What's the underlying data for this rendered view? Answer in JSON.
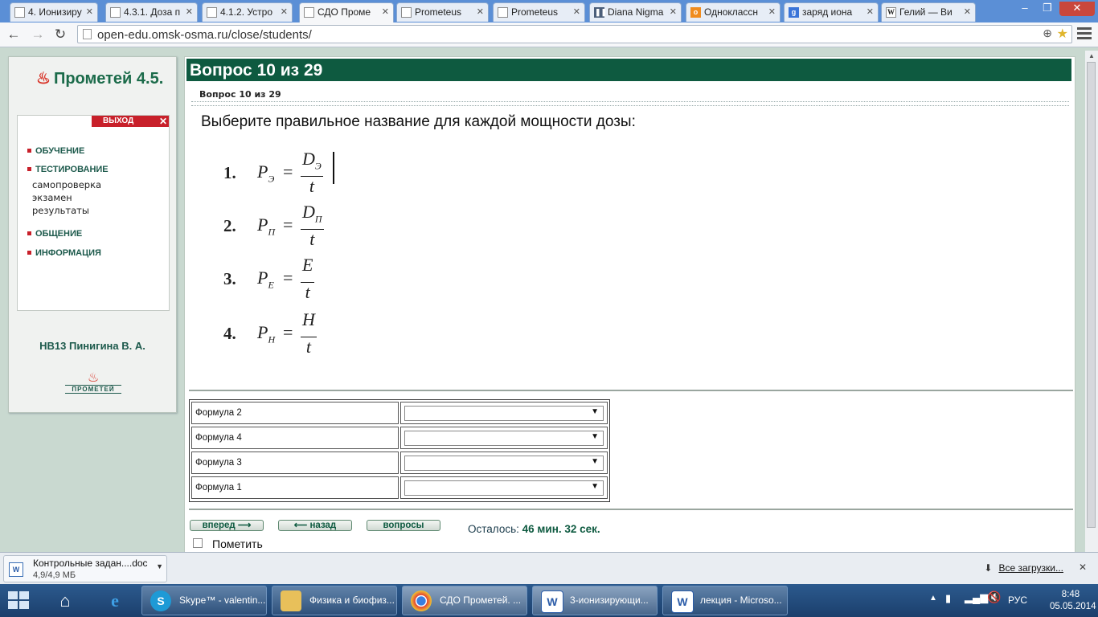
{
  "browser": {
    "tabs": [
      {
        "label": "4. Ионизиру",
        "icon": "document-icon"
      },
      {
        "label": "4.3.1. Доза п",
        "icon": "document-icon"
      },
      {
        "label": "4.1.2. Устро",
        "icon": "document-icon"
      },
      {
        "label": "СДО Проме",
        "icon": "document-icon",
        "active": true
      },
      {
        "label": "Prometeus",
        "icon": "document-icon"
      },
      {
        "label": "Prometeus",
        "icon": "document-icon"
      },
      {
        "label": "Diana Nigma",
        "icon": "pause-icon"
      },
      {
        "label": "Одноклассн",
        "icon": "odnoklassniki-icon"
      },
      {
        "label": "заряд иона",
        "icon": "google-icon"
      },
      {
        "label": "Гелий — Ви",
        "icon": "wikipedia-icon"
      }
    ],
    "url": "open-edu.omsk-osma.ru/close/students/"
  },
  "sidebar": {
    "logo_text": "Прометей 4.5.",
    "exit_label": "ВЫХОД",
    "menu": {
      "learning": "ОБУЧЕНИЕ",
      "testing": "ТЕСТИРОВАНИЕ",
      "self_check": "самопроверка",
      "exam": "экзамен",
      "results": "результаты",
      "communication": "ОБЩЕНИЕ",
      "information": "ИНФОРМАЦИЯ"
    },
    "user_name": "НВ13 Пинигина В. А.",
    "bottom_logo_text": "ПРОМЕТЕЙ"
  },
  "question": {
    "header": "Вопрос 10 из 29",
    "subheader": "Вопрос 10 из 29",
    "text": "Выберите правильное название для каждой мощности дозы:",
    "formulas": [
      {
        "num": "1.",
        "p": "P",
        "p_sub": "Э",
        "eq": "=",
        "numerator": "D",
        "numerator_sub": "Э",
        "denominator": "t"
      },
      {
        "num": "2.",
        "p": "P",
        "p_sub": "П",
        "eq": "=",
        "numerator": "D",
        "numerator_sub": "П",
        "denominator": "t"
      },
      {
        "num": "3.",
        "p": "P",
        "p_sub": "E",
        "eq": "=",
        "numerator": "E",
        "numerator_sub": "",
        "denominator": "t"
      },
      {
        "num": "4.",
        "p": "P",
        "p_sub": "H",
        "eq": "=",
        "numerator": "H",
        "numerator_sub": "",
        "denominator": "t"
      }
    ],
    "matching": [
      {
        "label": "Формула 2",
        "selected": ""
      },
      {
        "label": "Формула 4",
        "selected": ""
      },
      {
        "label": "Формула 3",
        "selected": ""
      },
      {
        "label": "Формула 1",
        "selected": ""
      }
    ]
  },
  "navigation": {
    "forward": "вперед",
    "back": "назад",
    "questions": "вопросы",
    "remaining_label": "Осталось:",
    "remaining_value": "46 мин. 32 сек.",
    "mark_label": "Пометить"
  },
  "downloads": {
    "file_name": "Контрольные задан....doc",
    "file_size": "4,9/4,9 МБ",
    "all_downloads": "Все загрузки..."
  },
  "taskbar": {
    "tasks": [
      {
        "label": "Skype™ - valentin...",
        "icon": "skype-icon"
      },
      {
        "label": "Физика и биофиз...",
        "icon": "folder-icon"
      },
      {
        "label": "СДО Прометей. ...",
        "icon": "chrome-icon"
      },
      {
        "label": "3-ионизирующи...",
        "icon": "word-icon"
      },
      {
        "label": "лекция - Microso...",
        "icon": "word-icon"
      }
    ],
    "language": "РУС",
    "time": "8:48",
    "date": "05.05.2014"
  }
}
